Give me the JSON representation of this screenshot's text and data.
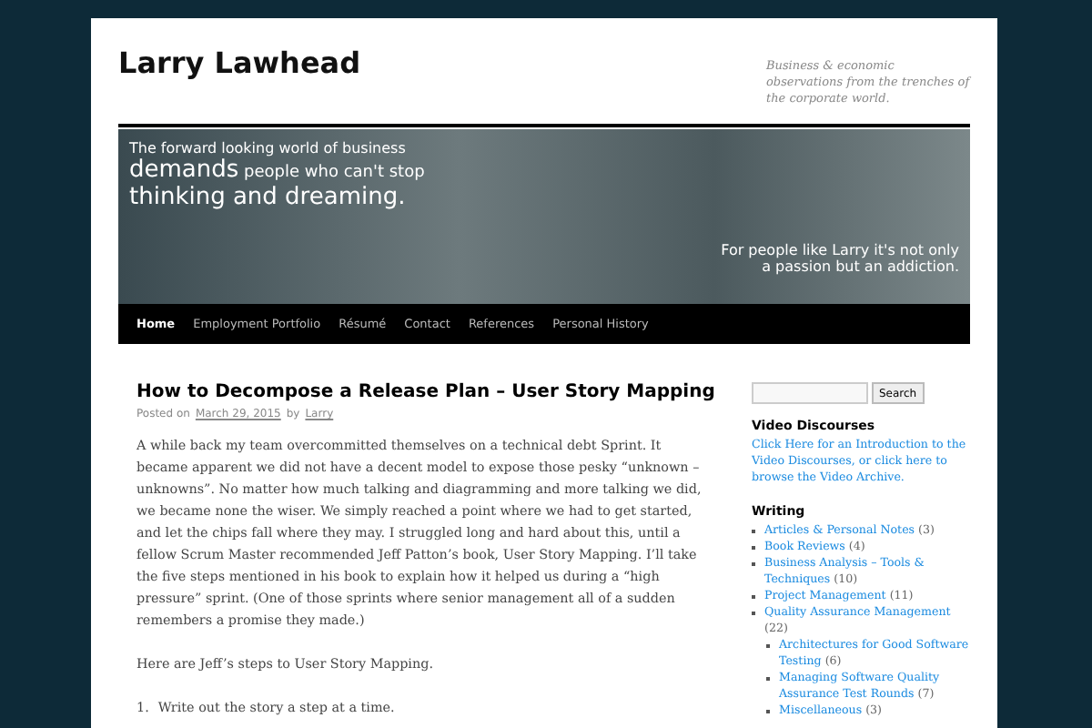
{
  "site": {
    "title": "Larry Lawhead",
    "tagline": "Business & economic observations from the trenches of the corporate world."
  },
  "banner": {
    "lines": [
      "The forward looking world of business",
      "**demands** people who can't stop",
      "thinking and dreaming."
    ],
    "side": [
      "For people like Larry it's not only",
      "a passion but an addiction."
    ]
  },
  "nav": [
    {
      "label": "Home",
      "selected": true
    },
    {
      "label": "Employment Portfolio",
      "selected": false
    },
    {
      "label": "Résumé",
      "selected": false
    },
    {
      "label": "Contact",
      "selected": false
    },
    {
      "label": "References",
      "selected": false
    },
    {
      "label": "Personal History",
      "selected": false
    }
  ],
  "post": {
    "title": "How to Decompose a Release Plan – User Story Mapping",
    "posted_on": "Posted on",
    "date": "March 29, 2015",
    "by": "by",
    "author": "Larry",
    "paragraphs": [
      "A while back my team overcommitted themselves on a technical debt Sprint. It became apparent we did not have a decent model to expose those pesky “unknown – unknowns”. No matter how much talking and diagramming and more talking we did, we became none the wiser. We simply reached a point where we had to get started, and let the chips fall where they may. I struggled long and hard about this, until a fellow Scrum Master recommended Jeff Patton’s book, User Story Mapping. I’ll take the five steps mentioned in his book to explain how it helped us during a “high pressure” sprint. (One of those sprints where senior management all of a sudden remembers a promise they made.)",
      "Here are Jeff’s steps to User Story Mapping."
    ],
    "steps": [
      {
        "number": "1.",
        "text": "Write out the story a step at a time."
      }
    ]
  },
  "sidebar": {
    "search_button": "Search",
    "video": {
      "heading": "Video Discourses",
      "text": "Click Here for an Introduction to the Video Discourses, or click here to browse the Video Archive."
    },
    "writing": {
      "heading": "Writing",
      "items": [
        {
          "label": "Articles & Personal Notes",
          "count": "(3)"
        },
        {
          "label": "Book Reviews",
          "count": "(4)"
        },
        {
          "label": "Business Analysis – Tools & Techniques",
          "count": "(10)"
        },
        {
          "label": "Project Management",
          "count": "(11)"
        },
        {
          "label": "Quality Assurance Management",
          "count": "(22)",
          "children": [
            {
              "label": "Architectures for Good Software Testing",
              "count": "(6)"
            },
            {
              "label": "Managing Software Quality Assurance Test Rounds",
              "count": "(7)"
            },
            {
              "label": "Miscellaneous",
              "count": "(3)"
            }
          ]
        }
      ]
    }
  }
}
